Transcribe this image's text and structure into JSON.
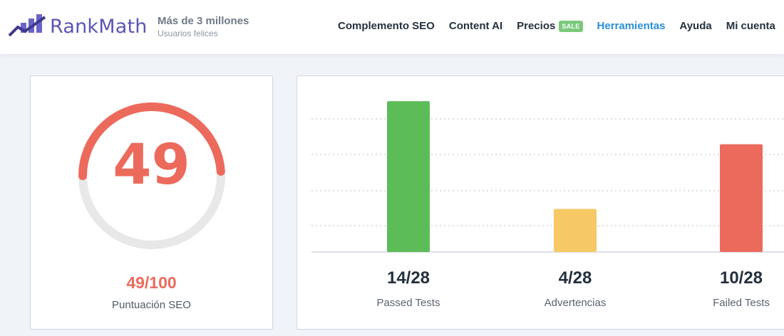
{
  "header": {
    "brand_rank": "Rank",
    "brand_math": "Math",
    "tagline_main": "Más de 3 millones",
    "tagline_sub": "Usuarios felices",
    "nav": [
      {
        "label": "Complemento SEO",
        "active": false
      },
      {
        "label": "Content AI",
        "active": false
      },
      {
        "label": "Precios",
        "badge": "SALE",
        "active": false
      },
      {
        "label": "Herramientas",
        "active": true
      },
      {
        "label": "Ayuda",
        "active": false
      },
      {
        "label": "Mi cuenta",
        "active": false
      }
    ]
  },
  "score": {
    "value": "49",
    "fraction": "49/100",
    "label": "Puntuación SEO",
    "percent": 49,
    "color": "#ec6a5c"
  },
  "tests": {
    "items": [
      {
        "value": "14/28",
        "label": "Passed Tests",
        "count": 14,
        "color": "#5cbc57"
      },
      {
        "value": "4/28",
        "label": "Advertencias",
        "count": 4,
        "color": "#f7c964"
      },
      {
        "value": "10/28",
        "label": "Failed Tests",
        "count": 10,
        "color": "#ec6a5c"
      }
    ]
  },
  "chart_data": {
    "type": "bar",
    "categories": [
      "Passed Tests",
      "Advertencias",
      "Failed Tests"
    ],
    "values": [
      14,
      4,
      10
    ],
    "ylim": [
      0,
      15
    ],
    "grid": true
  },
  "colors": {
    "accent": "#2b8fd6",
    "brand": "#5a55b5",
    "sale_badge": "#7bc97c"
  }
}
